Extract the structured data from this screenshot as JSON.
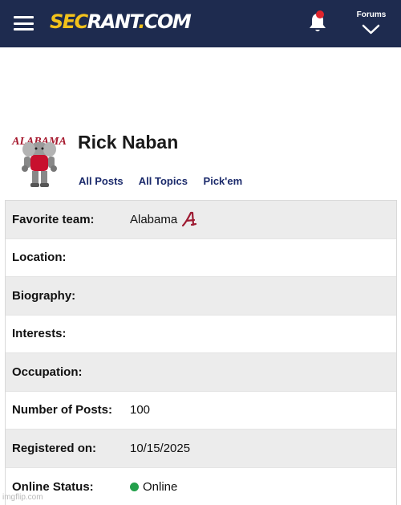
{
  "header": {
    "logo": {
      "part1": "SEC",
      "part2": "RANT",
      "part3": ".",
      "part4": "COM"
    },
    "forums_label": "Forums",
    "icons": {
      "menu": "hamburger-menu-icon",
      "notifications": "bell-icon",
      "forums": "chevron-down-icon"
    },
    "colors": {
      "bar": "#1e2b4f",
      "logo_accent": "#f2c21b",
      "notification_dot": "#e0242c"
    }
  },
  "profile": {
    "avatar_text": "ALABAMA",
    "name": "Rick Naban",
    "links": [
      "All Posts",
      "All Topics",
      "Pick'em"
    ]
  },
  "details": [
    {
      "label": "Favorite team:",
      "value": "Alabama"
    },
    {
      "label": "Location:",
      "value": ""
    },
    {
      "label": "Biography:",
      "value": ""
    },
    {
      "label": "Interests:",
      "value": ""
    },
    {
      "label": "Occupation:",
      "value": ""
    },
    {
      "label": "Number of Posts:",
      "value": "100"
    },
    {
      "label": "Registered on:",
      "value": "10/15/2025"
    },
    {
      "label": "Online Status:",
      "value": "Online"
    }
  ],
  "status_color": "#23a04b",
  "watermark": "imgflip.com"
}
